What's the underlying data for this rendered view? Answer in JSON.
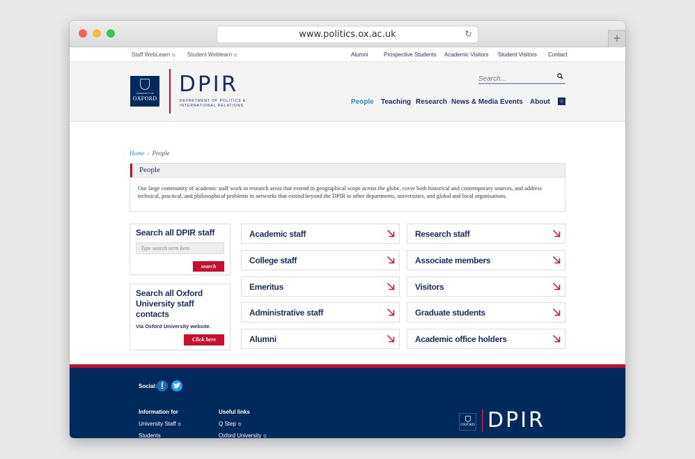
{
  "browser": {
    "url": "www.politics.ox.ac.uk",
    "reload_icon": "↻",
    "new_tab_icon": "+"
  },
  "topbar": {
    "left_links": [
      {
        "label": "Staff WebLearn",
        "external": true
      },
      {
        "label": "Student Weblearn",
        "external": true
      }
    ],
    "right_links": [
      {
        "label": "Alumni"
      },
      {
        "label": "Prospective Students"
      },
      {
        "label": "Academic Visitors"
      },
      {
        "label": "Student Visitors"
      },
      {
        "label": "Contact"
      }
    ],
    "external_icon": "⧉"
  },
  "header": {
    "oxford_logo": {
      "line1": "UNIVERSITY OF",
      "line2": "OXFORD"
    },
    "brand": "DPIR",
    "brand_sub_line1": "DEPARTMENT OF POLITICS &",
    "brand_sub_line2": "INTERNATIONAL RELATIONS",
    "search_placeholder": "Search...",
    "search_icon": "🔍",
    "nav": [
      {
        "label": "People",
        "active": true
      },
      {
        "label": "Teaching",
        "active": false
      },
      {
        "label": "Research",
        "active": false
      },
      {
        "label": "News & Media",
        "active": false
      },
      {
        "label": "Events",
        "active": false
      },
      {
        "label": "About",
        "active": false
      }
    ],
    "home_icon": "⌂"
  },
  "breadcrumb": {
    "home": "Home",
    "separator": "›",
    "current": "People"
  },
  "intro": {
    "title": "People",
    "body": "Our large community of academic staff work in research areas that extend in geographical scope across the globe, cover both historical and contemporary sources, and address technical, practical, and philosophical problems in networks that extend beyond the DPIR to other departments, universities, and global and local organisations."
  },
  "sidebar": {
    "staff_search": {
      "title": "Search all DPIR staff",
      "placeholder": "Type search term here",
      "button": "search"
    },
    "oxford_search": {
      "title": "Search all Oxford University staff contacts",
      "note": "Via Oxford University website.",
      "button": "Click here"
    }
  },
  "categories": {
    "left": [
      "Academic staff",
      "College staff",
      "Emeritus",
      "Administrative staff",
      "Alumni"
    ],
    "right": [
      "Research staff",
      "Associate members",
      "Visitors",
      "Graduate students",
      "Academic office holders"
    ]
  },
  "footer": {
    "social_label": "Social:",
    "facebook_icon": "f",
    "twitter_icon": "t",
    "info_heading": "Information for",
    "info_links": [
      "University Staff",
      "Students"
    ],
    "useful_heading": "Useful links",
    "useful_links": [
      "Q Step",
      "Oxford University"
    ],
    "brand": "DPIR",
    "oxford_logo": "OXFORD"
  },
  "colors": {
    "navy": "#1b2f5e",
    "footer_navy": "#002a5c",
    "accent_red": "#c8102e",
    "active_blue": "#2a8cc4"
  }
}
